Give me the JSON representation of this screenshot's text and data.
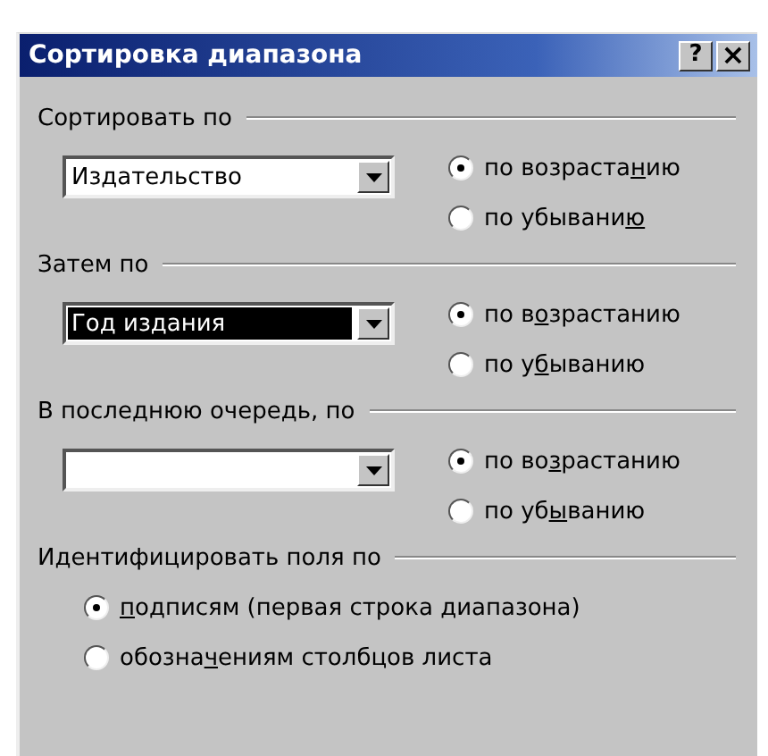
{
  "window": {
    "title": "Сортировка диапазона"
  },
  "title_buttons": [
    {
      "kind": "help",
      "label": "?"
    },
    {
      "kind": "close",
      "label": "×"
    }
  ],
  "sort_levels": [
    {
      "heading": "Сортировать по",
      "combo": {
        "value": "Издательство",
        "highlighted": false
      },
      "options": [
        {
          "before": "по возраста",
          "hotkey": "н",
          "after": "ию",
          "selected": true
        },
        {
          "before": "по убывани",
          "hotkey": "ю",
          "selected": false
        }
      ]
    },
    {
      "heading": "Затем по",
      "combo": {
        "value": "Год издания",
        "highlighted": true
      },
      "options": [
        {
          "before": "по в",
          "hotkey": "о",
          "after": "зрастанию",
          "selected": true
        },
        {
          "before": "по у",
          "hotkey": "б",
          "after": "ыванию",
          "selected": false
        }
      ]
    },
    {
      "heading": "В последнюю очередь, по",
      "combo": {
        "highlighted": false
      },
      "options": [
        {
          "before": "по во",
          "hotkey": "з",
          "after": "растанию",
          "selected": true
        },
        {
          "before": "по уб",
          "hotkey": "ы",
          "after": "ванию",
          "selected": false
        }
      ]
    }
  ],
  "identify": {
    "heading": "Идентифицировать поля по",
    "options": [
      {
        "hotkey": "п",
        "after": "одписям (первая строка диапазона)",
        "selected": true
      },
      {
        "before": "обозна",
        "hotkey": "ч",
        "after": "ениям столбцов листа",
        "selected": false
      }
    ]
  }
}
